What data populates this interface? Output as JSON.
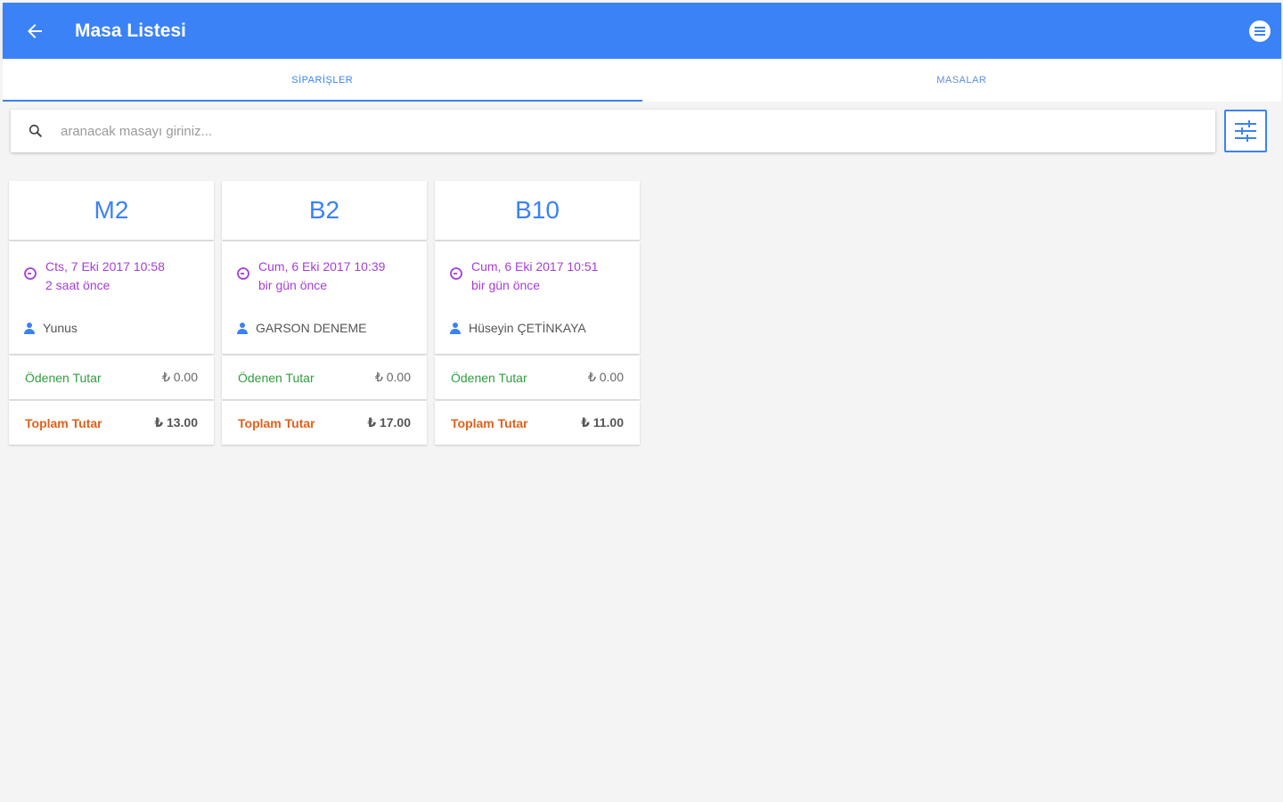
{
  "header": {
    "title": "Masa Listesi",
    "back_icon": "arrow-left-icon",
    "menu_icon": "more-circle-icon",
    "color": "#3b82f6"
  },
  "tabs": [
    {
      "label": "SİPARİŞLER",
      "active": true
    },
    {
      "label": "MASALAR",
      "active": false
    }
  ],
  "search": {
    "placeholder": "aranacak masayı giriniz...",
    "value": "",
    "icon": "search-icon",
    "filter_icon": "sliders-icon"
  },
  "cards": [
    {
      "name": "M2",
      "date": "Cts, 7 Eki 2017 10:58",
      "ago": "2 saat önce",
      "waiter": "Yunus",
      "paid_label": "Ödenen Tutar",
      "paid_value": "₺ 0.00",
      "total_label": "Toplam Tutar",
      "total_value": "₺ 13.00"
    },
    {
      "name": "B2",
      "date": "Cum, 6 Eki 2017 10:39",
      "ago": "bir gün önce",
      "waiter": "GARSON DENEME",
      "paid_label": "Ödenen Tutar",
      "paid_value": "₺ 0.00",
      "total_label": "Toplam Tutar",
      "total_value": "₺ 17.00"
    },
    {
      "name": "B10",
      "date": "Cum, 6 Eki 2017 10:51",
      "ago": "bir gün önce",
      "waiter": "Hüseyin ÇETİNKAYA",
      "paid_label": "Ödenen Tutar",
      "paid_value": "₺ 0.00",
      "total_label": "Toplam Tutar",
      "total_value": "₺ 11.00"
    }
  ],
  "colors": {
    "accent": "#3b82f6",
    "time": "#a63dd8",
    "paid": "#2e9e3e",
    "total": "#e2601a"
  }
}
